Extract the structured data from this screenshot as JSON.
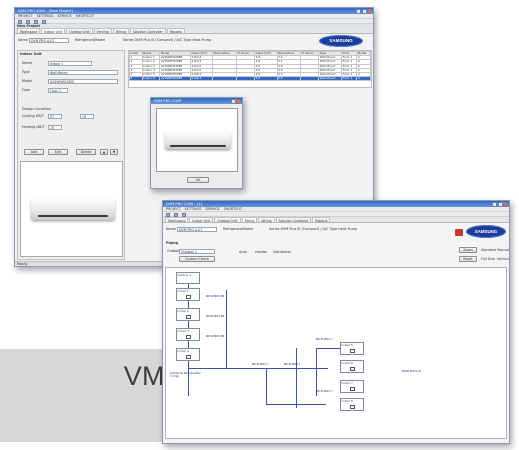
{
  "product_label": "VM-Pro",
  "window_a": {
    "title": "DVM PRO 2009 - [New Project]",
    "menu": [
      "PROJECT",
      "SETTINGS",
      "SERVICE",
      "SHORTCUT"
    ],
    "section": "New Project",
    "tabs": [
      "Workspace",
      "Indoor Unit",
      "Outdoor Unit",
      "Venting",
      "Wiring",
      "Solution Controller",
      "Reports"
    ],
    "name_label": "Name",
    "name_value": "DVM PRO A-01",
    "refrigerant_label": "Refrigerant/Model",
    "series_text": "Series DVM Plus III (Compact) / A/C Type Heat Pump",
    "logo_text": "SAMSUNG",
    "panel_title": "Indoor Unit",
    "fields": [
      {
        "label": "Name",
        "value": "Indoor 1"
      },
      {
        "label": "Type",
        "value": "Wall Mount"
      },
      {
        "label": "Model",
        "value": "AVXWNH028EE"
      },
      {
        "label": "Floor",
        "value": "Floor 1"
      }
    ],
    "design_title": "Design Condition",
    "cooling_label": "Cooling DB/T",
    "cooling_db": "27",
    "cooling_wb": "19",
    "heating_label": "Heating DB/T",
    "heating_db": "20",
    "buttons": [
      "Add",
      "Edit",
      "Delete"
    ],
    "table_headers": [
      "Index",
      "Name",
      "Model",
      "Capa (C/H)",
      "Room/Zone",
      "Tr. Room",
      "Capa (C/H)",
      "Room/Zone",
      "Tr. Room",
      "Type",
      "Floor",
      "Model"
    ],
    "table_rows": [
      [
        "1",
        "Indoor 1",
        "AVXWNH028EE",
        "2.8/3.2",
        "",
        "",
        "2.8",
        "3.2",
        "",
        "Wall Mount",
        "Floor 1",
        "A"
      ],
      [
        "2",
        "Indoor 2",
        "AVXWNH028EE",
        "2.8/3.2",
        "",
        "",
        "2.8",
        "3.2",
        "",
        "Wall Mount",
        "Floor 1",
        "A"
      ],
      [
        "3",
        "Indoor 3",
        "AVXWNH036EE",
        "3.6/4.0",
        "",
        "",
        "3.6",
        "4.0",
        "",
        "Wall Mount",
        "Floor 1",
        "A"
      ],
      [
        "4",
        "Indoor 4",
        "AVXWNH036EE",
        "3.6/4.0",
        "",
        "",
        "3.6",
        "4.0",
        "",
        "Wall Mount",
        "Floor 1",
        "A"
      ],
      [
        "5",
        "Indoor 5",
        "AVXWNH056EE",
        "5.6/6.3",
        "",
        "",
        "5.6",
        "6.3",
        "",
        "Wall Mount",
        "Floor 1",
        "A"
      ],
      [
        "6",
        "Indoor 6",
        "AVXWNH056EE",
        "5.6/6.3",
        "",
        "",
        "5.6",
        "6.3",
        "",
        "Wall Mount",
        "Floor 1",
        "A"
      ]
    ],
    "status": "Ready"
  },
  "dialog": {
    "title": "DVM PRO 2009",
    "ok_label": "OK"
  },
  "window_b": {
    "title": "DVM PRO 2009 - [1]",
    "menu": [
      "PROJECT",
      "SETTINGS",
      "SERVICE",
      "SHORTCUT"
    ],
    "tabs": [
      "Workspace",
      "Indoor Unit",
      "Outdoor Unit",
      "Piping",
      "Wiring",
      "Solution Controller",
      "Reports"
    ],
    "name_label": "Name",
    "name_value": "DVM PRO A-01",
    "refrigerant_label": "Refrigerant/Model",
    "series_text": "Series DVM Plus III (Compact) / A/C Type Heat Pump",
    "logo_text": "SAMSUNG",
    "piping_label": "Piping",
    "outdoor_label": "Outdoor",
    "outdoor_value": "Outdoor 1",
    "system_check": "System Check",
    "opt_labels": [
      "Auto",
      "Header",
      "Distributor"
    ],
    "zoom_btn": "Zoom",
    "reset_btn": "Reset",
    "radio_labels": [
      "Standard",
      "Manual",
      "Full Size",
      "Vertical"
    ],
    "diagram": {
      "outdoor_box": "Outdoor 1",
      "left_units": [
        "Indoor 1",
        "Indoor 2",
        "Indoor 3",
        "Indoor 4"
      ],
      "right_units": [
        "Indoor 5",
        "Indoor 6",
        "Indoor 7",
        "Indoor 8"
      ],
      "pipe_labels": [
        "Φ9.52/Φ15.88",
        "Φ9.52/Φ15.88",
        "Φ9.52/Φ15.88",
        "Φ6.35/Φ12.7",
        "Φ6.35/Φ12.7",
        "Φ6.35/Φ12.7",
        "Φ6.35/Φ12.7"
      ],
      "note": "Additional Ref. Quantity 3.72kg",
      "diagram_tag": "DVM PLUS III"
    }
  }
}
